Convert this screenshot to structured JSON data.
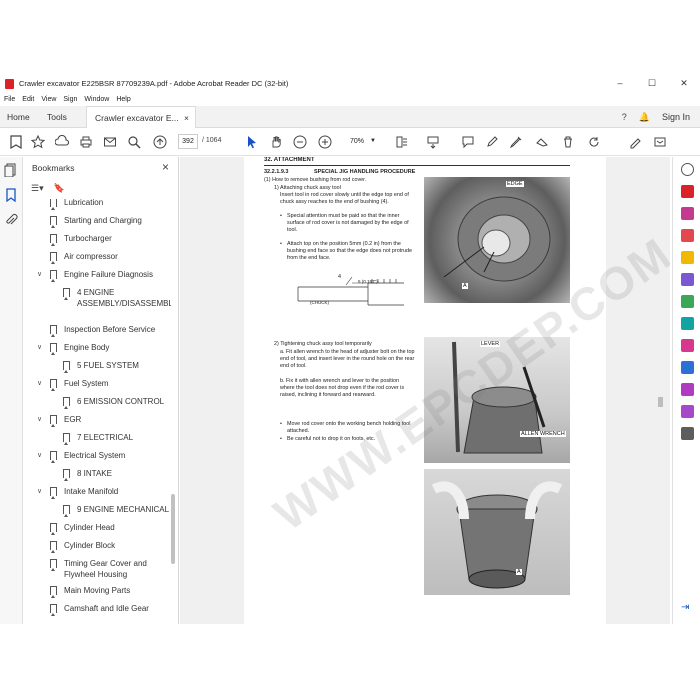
{
  "window": {
    "title": "Crawler excavator E225BSR 87709239A.pdf - Adobe Acrobat Reader DC (32-bit)",
    "controls": [
      "–",
      "☐",
      "✕"
    ]
  },
  "menu": [
    "File",
    "Edit",
    "View",
    "Sign",
    "Window",
    "Help"
  ],
  "tabs": {
    "home": "Home",
    "tools": "Tools",
    "document": "Crawler excavator E...",
    "close": "×",
    "sign_in": "Sign In"
  },
  "toolbar": {
    "page_current": "392",
    "page_total": "/ 1064",
    "zoom": "70%"
  },
  "bookmarks": {
    "header": "Bookmarks",
    "close": "×",
    "items": [
      {
        "label": "Lubrication",
        "level": 1,
        "expand": false
      },
      {
        "label": "Starting and Charging",
        "level": 1,
        "expand": false
      },
      {
        "label": "Turbocharger",
        "level": 1,
        "expand": false
      },
      {
        "label": "Air compressor",
        "level": 1,
        "expand": false
      },
      {
        "label": "Engine Failure Diagnosis",
        "level": 1,
        "expand": true
      },
      {
        "label": "4 ENGINE ASSEMBLY/DISASSEMBLY",
        "level": 2,
        "expand": false
      },
      {
        "label": "Inspection Before Service",
        "level": 1,
        "expand": false
      },
      {
        "label": "Engine Body",
        "level": 1,
        "expand": true
      },
      {
        "label": "5 FUEL SYSTEM",
        "level": 2,
        "expand": false
      },
      {
        "label": "Fuel System",
        "level": 1,
        "expand": true
      },
      {
        "label": "6 EMISSION CONTROL",
        "level": 2,
        "expand": false
      },
      {
        "label": "EGR",
        "level": 1,
        "expand": true
      },
      {
        "label": "7 ELECTRICAL",
        "level": 2,
        "expand": false
      },
      {
        "label": "Electrical System",
        "level": 1,
        "expand": true
      },
      {
        "label": "8 INTAKE",
        "level": 2,
        "expand": false
      },
      {
        "label": "Intake Manifold",
        "level": 1,
        "expand": true
      },
      {
        "label": "9 ENGINE MECHANICAL",
        "level": 2,
        "expand": false
      },
      {
        "label": "Cylinder Head",
        "level": 1,
        "expand": false
      },
      {
        "label": "Cylinder Block",
        "level": 1,
        "expand": false
      },
      {
        "label": "Timing Gear Cover and Flywheel Housing",
        "level": 1,
        "expand": false
      },
      {
        "label": "Main Moving Parts",
        "level": 1,
        "expand": false
      },
      {
        "label": "Camshaft and Idle Gear",
        "level": 1,
        "expand": false
      }
    ]
  },
  "page": {
    "section_header": "32. ATTACHMENT",
    "procedure_num": "32.2.1.9.3",
    "procedure_title": "SPECIAL JIG HANDLING PROCEDURE",
    "step1": "(1)  How to remove bushing from rod cover.",
    "step1_1": "1) Attaching chuck assy tool",
    "step1_1_text": "Insert tool in rod cover slowly until the edge top end of chuck assy reaches to the end of bushing (4).",
    "bullet1": "Special attention must be paid so that the inner surface of rod cover is not damaged by the edge of tool.",
    "bullet2": "Attach top on the position 5mm (0.2 in) from the bushing end face so that the edge does not protrude from the end face.",
    "diagram_num": "4",
    "diagram_dim": "5 (0.197\")",
    "diagram_label": "(CHUCK)",
    "step2": "2) Tightening chuck assy tool temporarily",
    "step2_a": "a.  Fit allen wrench to the head of adjuster bolt on the top end of tool, and insert lever in the round hole on the rear end of tool.",
    "step2_b": "b.  Fix it with allen wrench and lever to the position where the tool does not drop even if the rod cover is raised, inclining it forward and rearward.",
    "bullet3": "Move rod cover onto the working bench holding tool attached.",
    "bullet4": "Be careful not to drop it on foots, etc.",
    "photo1_edge": "EDGE",
    "photo1_a": "A",
    "photo2_lever": "LEVER",
    "photo2_wrench": "ALLEN WRENCH",
    "photo3_a": "A",
    "watermark": "WWW.EPCDEP.COM"
  }
}
